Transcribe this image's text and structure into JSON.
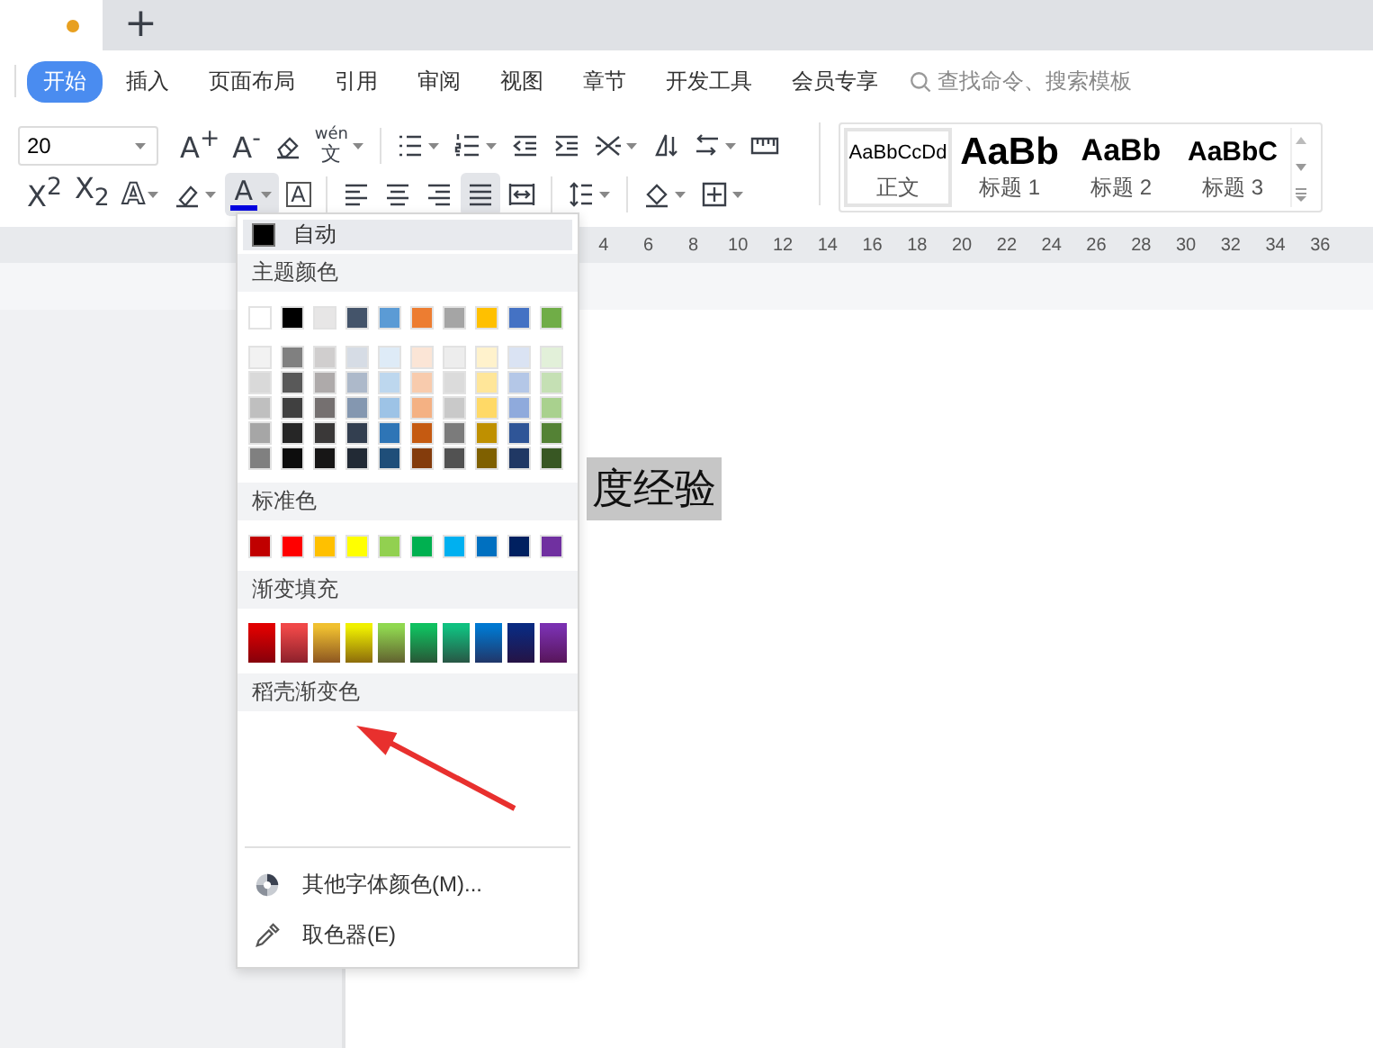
{
  "doc_tabs": {
    "modified": true,
    "new_tab": "+"
  },
  "ribbon_tabs": [
    {
      "label": "开始",
      "selected": true
    },
    {
      "label": "插入",
      "selected": false
    },
    {
      "label": "页面布局",
      "selected": false
    },
    {
      "label": "引用",
      "selected": false
    },
    {
      "label": "审阅",
      "selected": false
    },
    {
      "label": "视图",
      "selected": false
    },
    {
      "label": "章节",
      "selected": false
    },
    {
      "label": "开发工具",
      "selected": false
    },
    {
      "label": "会员专享",
      "selected": false
    }
  ],
  "search": {
    "placeholder": "查找命令、搜索模板"
  },
  "font_size": {
    "value": "20"
  },
  "toolbar_rows": [
    [
      {
        "kind": "glyph",
        "text": "A$^{+}$",
        "caret": false,
        "selected": false
      },
      {
        "kind": "glyph",
        "text": "A$^{-}$",
        "caret": false,
        "selected": false
      },
      {
        "kind": "eraser",
        "caret": false,
        "selected": false
      },
      {
        "kind": "ruby",
        "text": "文",
        "ruby": "wén",
        "caret": true,
        "selected": false
      },
      {
        "kind": "separator"
      },
      {
        "kind": "bullets",
        "caret": true,
        "selected": false
      },
      {
        "kind": "numbering",
        "caret": true,
        "selected": false
      },
      {
        "kind": "outdent",
        "caret": false,
        "selected": false
      },
      {
        "kind": "indent",
        "caret": false,
        "selected": false
      },
      {
        "kind": "cross",
        "caret": true,
        "selected": false
      },
      {
        "kind": "sort",
        "caret": false,
        "selected": false
      },
      {
        "kind": "linebreak",
        "caret": true,
        "selected": false
      },
      {
        "kind": "ruler",
        "caret": false,
        "selected": false
      }
    ],
    [
      {
        "kind": "glyph",
        "text": "X$^{2}$",
        "caret": false,
        "selected": false
      },
      {
        "kind": "glyph",
        "text": "X$_{2}$",
        "caret": false,
        "selected": false
      },
      {
        "kind": "outline",
        "text": "A",
        "caret": true,
        "selected": false
      },
      {
        "kind": "highlight",
        "caret": true,
        "selected": false
      },
      {
        "kind": "color",
        "text": "A",
        "caret": true,
        "selected": true
      },
      {
        "kind": "boxed",
        "text": "A",
        "caret": false,
        "selected": false
      },
      {
        "kind": "separator"
      },
      {
        "kind": "left",
        "caret": false,
        "selected": false
      },
      {
        "kind": "center",
        "caret": false,
        "selected": false
      },
      {
        "kind": "right",
        "caret": false,
        "selected": false
      },
      {
        "kind": "justify",
        "caret": false,
        "selected": true
      },
      {
        "kind": "distributed",
        "caret": false,
        "selected": false
      },
      {
        "kind": "separator"
      },
      {
        "kind": "spacing",
        "caret": true,
        "selected": false
      },
      {
        "kind": "separator"
      },
      {
        "kind": "shading",
        "caret": true,
        "selected": false
      },
      {
        "kind": "borders",
        "caret": true,
        "selected": false
      }
    ]
  ],
  "styles": [
    {
      "kind": "normal",
      "preview": "AaBbCcDd",
      "label": "正文",
      "selected": true
    },
    {
      "kind": "heading1",
      "preview": "AaBb",
      "label": "标题 1",
      "selected": false
    },
    {
      "kind": "heading2",
      "preview": "AaBb",
      "label": "标题 2",
      "selected": false
    },
    {
      "kind": "heading3",
      "preview": "AaBbC",
      "label": "标题 3",
      "selected": false
    }
  ],
  "ruler": [
    "4",
    "6",
    "8",
    "10",
    "12",
    "14",
    "16",
    "18",
    "20",
    "22",
    "24",
    "26",
    "28",
    "30",
    "32",
    "34",
    "36"
  ],
  "document": {
    "text": "度经验",
    "highlighted": true
  },
  "color_menu": {
    "auto": {
      "label": "自动",
      "color": "#000000"
    },
    "sections": [
      {
        "title": "主题颜色",
        "kind": "solid",
        "swatches": [
          {
            "color": "#ffffff"
          },
          {
            "color": "#000000"
          },
          {
            "color": "#e7e6e6"
          },
          {
            "color": "#44546a"
          },
          {
            "color": "#5b9bd5"
          },
          {
            "color": "#ed7d31"
          },
          {
            "color": "#a5a5a5"
          },
          {
            "color": "#ffc000"
          },
          {
            "color": "#4472c4"
          },
          {
            "color": "#70ad47"
          }
        ],
        "shades": [
          [
            {
              "color": "#f2f2f2"
            },
            {
              "color": "#808080"
            },
            {
              "color": "#d0cece"
            },
            {
              "color": "#d6dce5"
            },
            {
              "color": "#deebf7"
            },
            {
              "color": "#fbe5d6"
            },
            {
              "color": "#ededed"
            },
            {
              "color": "#fff2cc"
            },
            {
              "color": "#dae3f3"
            },
            {
              "color": "#e2f0d9"
            }
          ],
          [
            {
              "color": "#d9d9d9"
            },
            {
              "color": "#595959"
            },
            {
              "color": "#aeaaaa"
            },
            {
              "color": "#adb9ca"
            },
            {
              "color": "#bdd7ee"
            },
            {
              "color": "#f8cbad"
            },
            {
              "color": "#dbdbdb"
            },
            {
              "color": "#ffe699"
            },
            {
              "color": "#b4c7e7"
            },
            {
              "color": "#c5e0b4"
            }
          ],
          [
            {
              "color": "#bfbfbf"
            },
            {
              "color": "#404040"
            },
            {
              "color": "#757070"
            },
            {
              "color": "#8497b0"
            },
            {
              "color": "#9dc3e6"
            },
            {
              "color": "#f4b183"
            },
            {
              "color": "#c9c9c9"
            },
            {
              "color": "#ffd966"
            },
            {
              "color": "#8faadc"
            },
            {
              "color": "#a9d18e"
            }
          ],
          [
            {
              "color": "#a6a6a6"
            },
            {
              "color": "#262626"
            },
            {
              "color": "#3a3838"
            },
            {
              "color": "#333f50"
            },
            {
              "color": "#2e75b6"
            },
            {
              "color": "#c55a11"
            },
            {
              "color": "#7b7b7b"
            },
            {
              "color": "#bf9000"
            },
            {
              "color": "#2f5597"
            },
            {
              "color": "#548235"
            }
          ],
          [
            {
              "color": "#808080"
            },
            {
              "color": "#0d0d0d"
            },
            {
              "color": "#171616"
            },
            {
              "color": "#222a35"
            },
            {
              "color": "#1f4e79"
            },
            {
              "color": "#843c0c"
            },
            {
              "color": "#525252"
            },
            {
              "color": "#7f6000"
            },
            {
              "color": "#203864"
            },
            {
              "color": "#385723"
            }
          ]
        ]
      },
      {
        "title": "标准色",
        "kind": "solid",
        "swatches": [
          {
            "color": "#c00000"
          },
          {
            "color": "#ff0000"
          },
          {
            "color": "#ffc000"
          },
          {
            "color": "#ffff00"
          },
          {
            "color": "#92d050"
          },
          {
            "color": "#00b050"
          },
          {
            "color": "#00b0f0"
          },
          {
            "color": "#0070c0"
          },
          {
            "color": "#002060"
          },
          {
            "color": "#7030a0"
          }
        ]
      },
      {
        "title": "渐变填充",
        "kind": "gradient",
        "swatches": [
          {
            "color": "#e00000"
          },
          {
            "color": "#f04848"
          },
          {
            "color": "#f0c030"
          },
          {
            "color": "#f0f000"
          },
          {
            "color": "#90d850"
          },
          {
            "color": "#10c060"
          },
          {
            "color": "#10c080"
          },
          {
            "color": "#0078d0"
          },
          {
            "color": "#0a2a80"
          },
          {
            "color": "#7a30b0"
          }
        ]
      },
      {
        "title": "稻壳渐变色",
        "kind": "empty"
      }
    ],
    "items": [
      {
        "kind": "palette",
        "label": "其他字体颜色(M)..."
      },
      {
        "kind": "eyedropper",
        "label": "取色器(E)"
      }
    ]
  }
}
